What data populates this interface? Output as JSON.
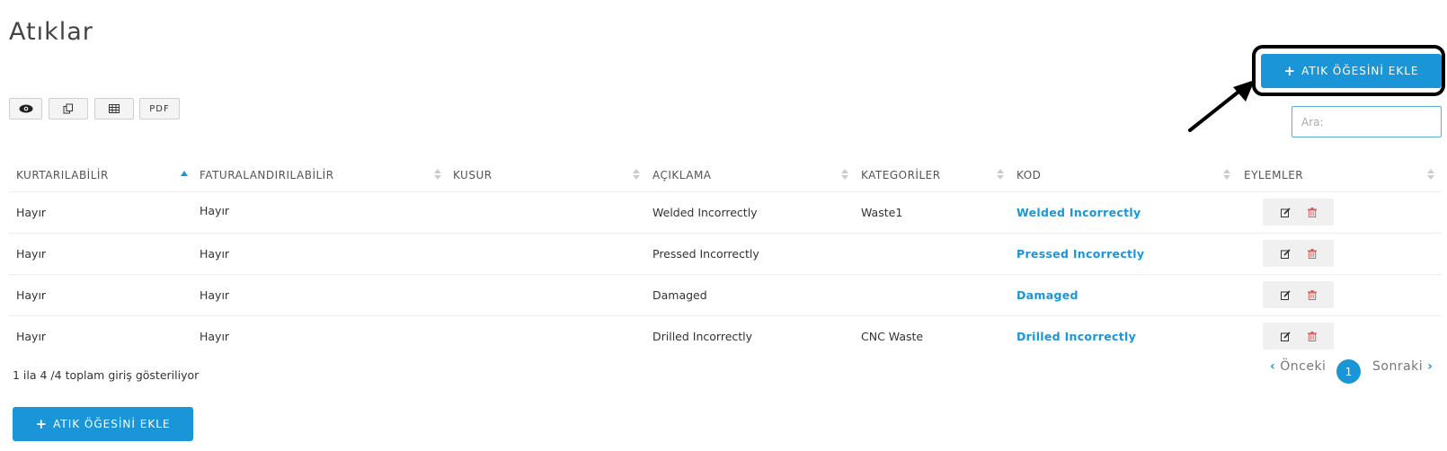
{
  "page": {
    "title": "Atıklar"
  },
  "actions": {
    "add_label": "ATIK ÖĞESİNİ EKLE"
  },
  "toolbar": {
    "pdf_label": "PDF"
  },
  "search": {
    "placeholder": "Ara:"
  },
  "table": {
    "columns": [
      "KURTARILABİLİR",
      "FATURALANDIRILABİLİR",
      "KUSUR",
      "AÇIKLAMA",
      "KATEGORİLER",
      "KOD",
      "EYLEMLER"
    ],
    "rows": [
      {
        "recoverable": "Hayır",
        "billable": "Hayır",
        "defect": "",
        "description": "Welded Incorrectly",
        "category": "Waste1",
        "code": "Welded Incorrectly"
      },
      {
        "recoverable": "Hayır",
        "billable": "Hayır",
        "defect": "",
        "description": "Pressed Incorrectly",
        "category": "",
        "code": "Pressed Incorrectly"
      },
      {
        "recoverable": "Hayır",
        "billable": "Hayır",
        "defect": "",
        "description": "Damaged",
        "category": "",
        "code": "Damaged"
      },
      {
        "recoverable": "Hayır",
        "billable": "Hayır",
        "defect": "",
        "description": "Drilled Incorrectly",
        "category": "CNC Waste",
        "code": "Drilled Incorrectly"
      }
    ]
  },
  "footer": {
    "info": "1 ila 4 /4 toplam giriş gösteriliyor",
    "prev_label": "Önceki",
    "next_label": "Sonraki",
    "current_page": "1"
  },
  "icons": {
    "view": "eye-icon",
    "copy": "copy-icon",
    "excel": "table-icon",
    "edit": "edit-icon",
    "delete": "trash-icon",
    "sort": "sort-icon"
  },
  "colors": {
    "accent": "#1a96d8",
    "danger": "#e05a5a"
  }
}
